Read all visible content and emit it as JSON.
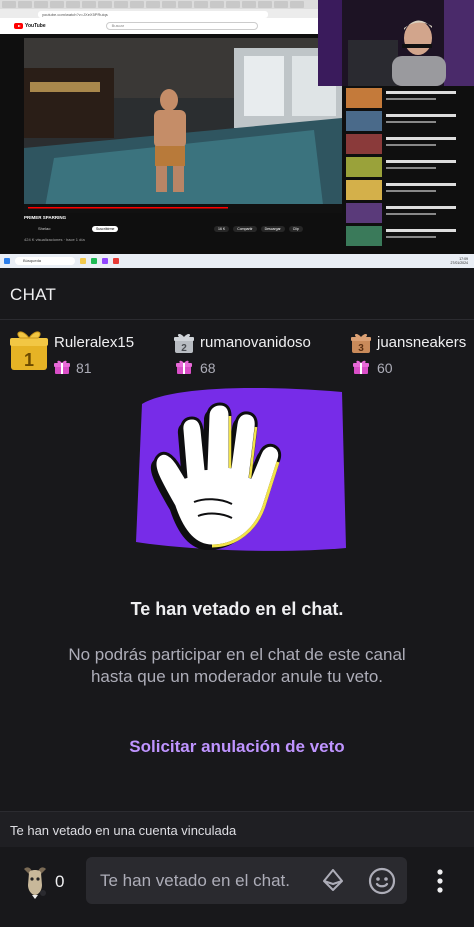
{
  "stream": {
    "address_bar": "youtube.com/watch?v=JXeX5PRuiqs",
    "yt_logo": "YouTube",
    "yt_search_placeholder": "Buscar",
    "video_title": "PRIMER SPARRING",
    "channel_name": "Shelao",
    "subscribe_label": "Suscribirme",
    "views": "424 K visualizaciones · hace 1 día",
    "actions": [
      "16 K",
      "Compartir",
      "Descargar",
      "Clip"
    ],
    "taskbar_search": "Búsqueda",
    "taskbar_clock_time": "17:09",
    "taskbar_clock_date": "27/01/2024"
  },
  "chat": {
    "title": "CHAT",
    "leaders": [
      {
        "rank": "1",
        "name": "Ruleralex15",
        "gifts": "81"
      },
      {
        "rank": "2",
        "name": "rumanovanidoso",
        "gifts": "68"
      },
      {
        "rank": "3",
        "name": "juansneakers",
        "gifts": "60"
      }
    ],
    "ban_title": "Te han vetado en el chat.",
    "ban_description": "No podrás participar en el chat de este canal hasta que un moderador anule tu veto.",
    "unban_link": "Solicitar anulación de veto",
    "linked_ban_text": "Te han vetado en una cuenta vinculada",
    "points": "0",
    "input_text": "Te han vetado en el chat."
  },
  "colors": {
    "background": "#18181b",
    "accent": "#bf94ff",
    "purple_panel": "#772ce8",
    "gold_badge": "#e6b325",
    "gift_pink": "#d94ec7",
    "input_bg": "#2a2a2f",
    "secondary_text": "#adadb8"
  },
  "icons": {
    "leader_badge": "gift-rank-badge-icon",
    "gift": "gift-icon",
    "avatar": "goat-avatar-icon",
    "bits": "bits-diamond-icon",
    "emote": "smiley-emote-icon",
    "more": "vertical-dots-icon"
  }
}
